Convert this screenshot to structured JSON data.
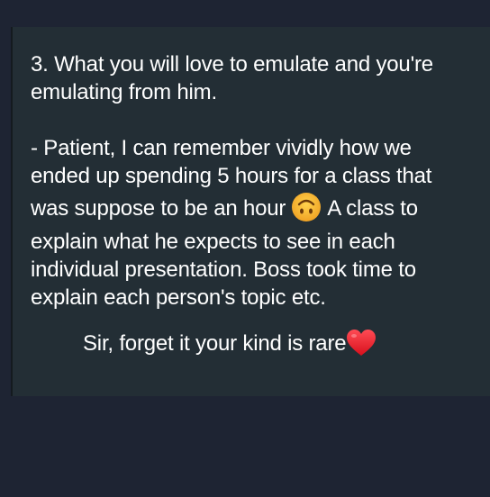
{
  "message": {
    "point_heading_lines": [
      "3. What you will love to emulate and you're",
      "emulating from him."
    ],
    "body_lines": [
      "- Patient, I can remember vividly how we",
      "ended up spending 5 hours for a class that"
    ],
    "line_with_emoji_before": "was suppose to be an hour",
    "emoji_1": "upside-down-face-icon",
    "line_with_emoji_after": "A class to",
    "body_lines_2": [
      "explain what he expects to see in each",
      "individual presentation. Boss took time to",
      "explain each person's topic etc."
    ],
    "closing_text": "Sir, forget it your kind is rare",
    "emoji_2": "red-heart-icon"
  },
  "colors": {
    "background": "#1e2433",
    "bubble": "#232e35",
    "text": "#ffffff",
    "emoji_face": "#f7b733",
    "heart": "#e8222e"
  }
}
